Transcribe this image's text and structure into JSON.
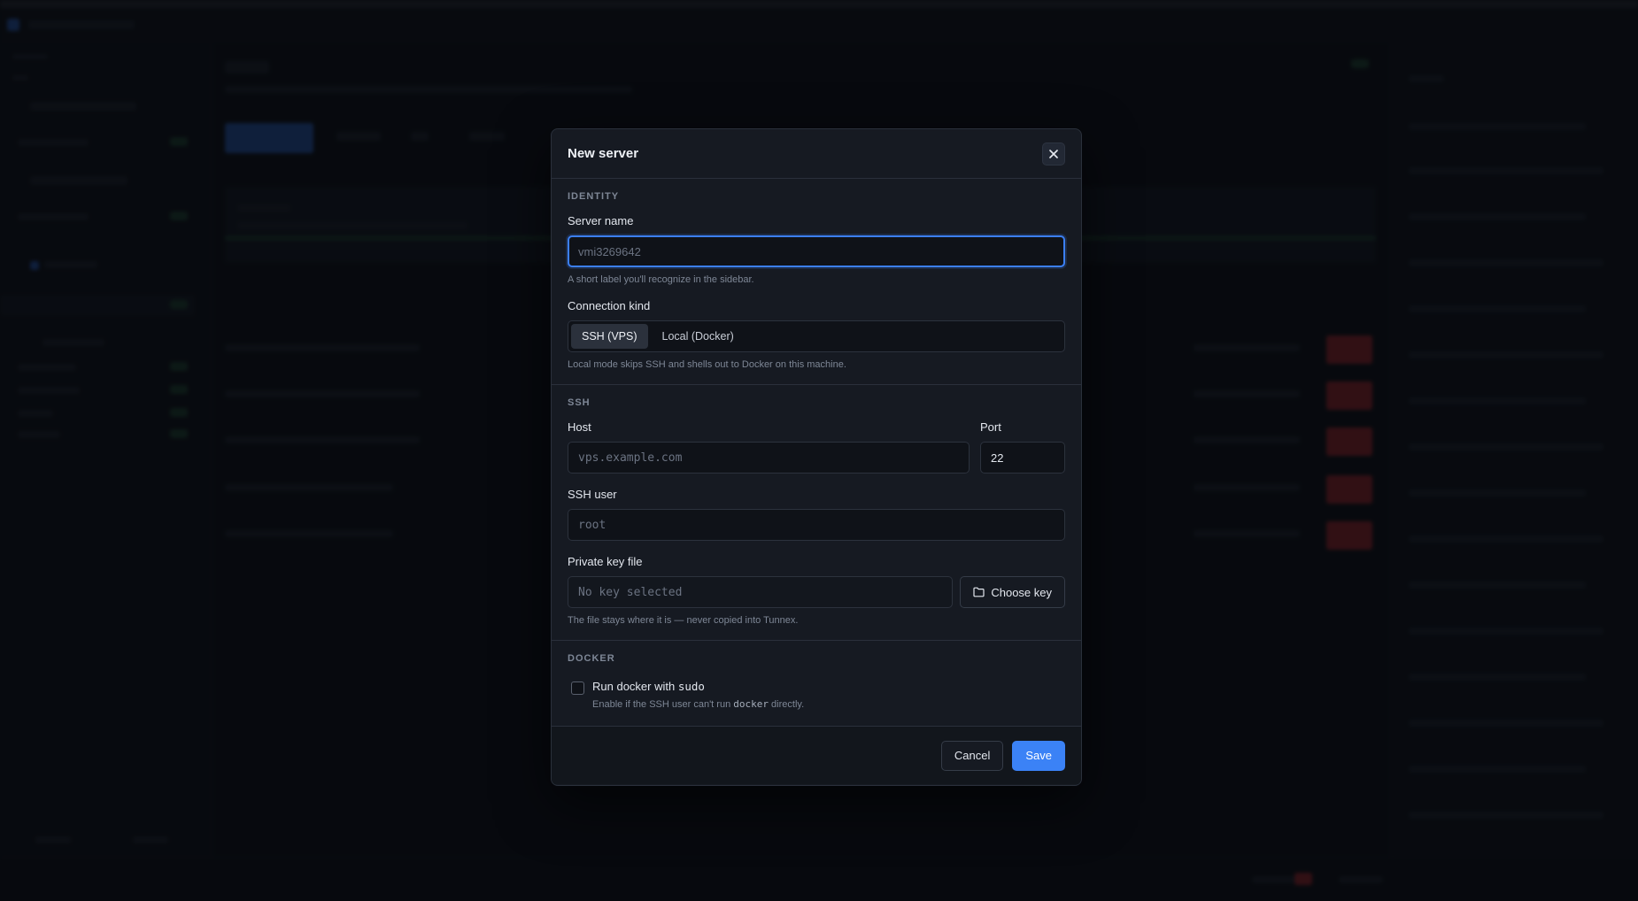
{
  "modal": {
    "title": "New server",
    "close_icon": "close-icon",
    "identity": {
      "section_title": "IDENTITY",
      "server_name_label": "Server name",
      "server_name_value": "",
      "server_name_placeholder": "vmi3269642",
      "server_name_hint": "A short label you'll recognize in the sidebar.",
      "connection_kind_label": "Connection kind",
      "connection_options": [
        "SSH (VPS)",
        "Local (Docker)"
      ],
      "connection_selected": "SSH (VPS)",
      "connection_hint": "Local mode skips SSH and shells out to Docker on this machine."
    },
    "ssh": {
      "section_title": "SSH",
      "host_label": "Host",
      "host_placeholder": "vps.example.com",
      "port_label": "Port",
      "port_value": "22",
      "user_label": "SSH user",
      "user_placeholder": "root",
      "key_label": "Private key file",
      "key_placeholder": "No key selected",
      "choose_key_label": "Choose key",
      "choose_key_icon": "folder-icon",
      "key_hint": "The file stays where it is — never copied into Tunnex."
    },
    "docker": {
      "section_title": "DOCKER",
      "sudo_label_prefix": "Run docker with ",
      "sudo_label_code": "sudo",
      "sudo_checked": false,
      "sudo_hint_prefix": "Enable if the SSH user can't run ",
      "sudo_hint_code": "docker",
      "sudo_hint_suffix": " directly."
    },
    "footer": {
      "cancel_label": "Cancel",
      "save_label": "Save"
    }
  },
  "colors": {
    "accent": "#3b82f6",
    "modal_bg": "#161a22",
    "danger": "#b3262c",
    "success": "#1f4d34"
  }
}
